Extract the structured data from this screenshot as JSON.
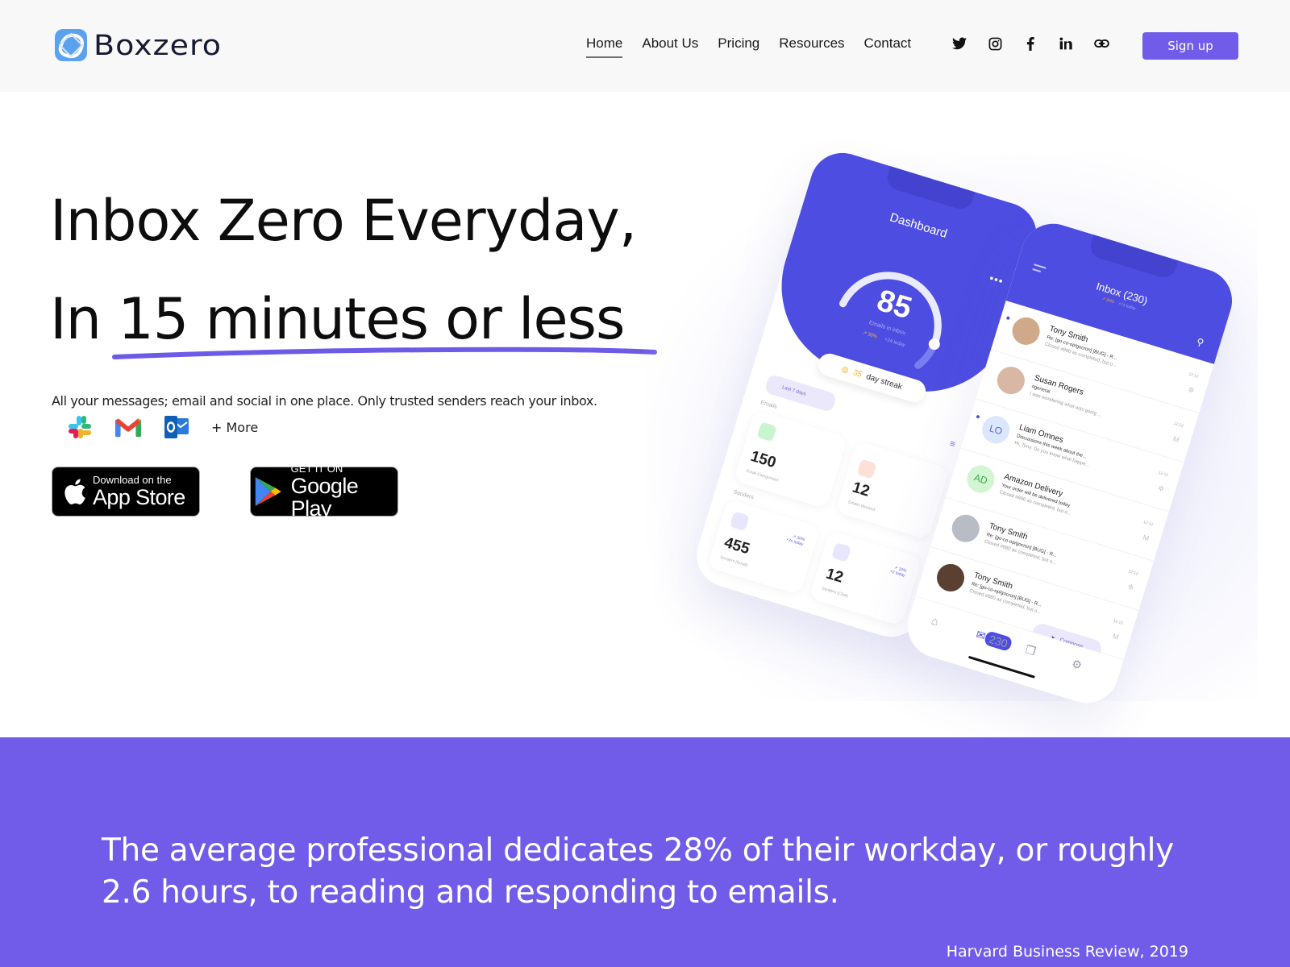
{
  "brand": {
    "name": "Boxzero",
    "accent": "#705ce8",
    "logo_icon": "box-logo-icon"
  },
  "nav": {
    "items": [
      {
        "label": "Home",
        "active": true
      },
      {
        "label": "About Us",
        "active": false
      },
      {
        "label": "Pricing",
        "active": false
      },
      {
        "label": "Resources",
        "active": false
      },
      {
        "label": "Contact",
        "active": false
      }
    ]
  },
  "social": [
    "twitter-icon",
    "instagram-icon",
    "facebook-icon",
    "linkedin-icon",
    "link-icon"
  ],
  "signup_label": "Sign up",
  "hero": {
    "title_line1": "Inbox Zero Everyday,",
    "title_line2": "In 15 minutes or less",
    "subtitle": "All your messages; email and social in one place. Only trusted senders reach your inbox.",
    "integrations": [
      "slack-icon",
      "gmail-icon",
      "outlook-icon"
    ],
    "more_label": "+ More",
    "app_store": {
      "small": "Download on the",
      "big": "App Store"
    },
    "google_play": {
      "small": "GET IT ON",
      "big": "Google Play"
    }
  },
  "dashboard_phone": {
    "title": "Dashboard",
    "gauge_value": "85",
    "gauge_fraction": 0.85,
    "gauge_label": "Emails in inbox",
    "trend_up": "↗ 30%",
    "trend_today": "+24 today",
    "streak_count": "35",
    "streak_label": "day streak",
    "range_label": "Last 7 days",
    "emails_section": "Emails",
    "senders_section": "Senders",
    "cards": [
      {
        "value": "150",
        "label": "Email Categorised"
      },
      {
        "value": "12",
        "label": "Emails Blocked"
      },
      {
        "value": "455",
        "label": "Senders (Email)",
        "trend": "↗ 30%",
        "today": "+2x today"
      },
      {
        "value": "12",
        "label": "Senders (Chat)",
        "trend": "↗ 10%",
        "today": "+2 today"
      }
    ]
  },
  "inbox_phone": {
    "title": "Inbox (230)",
    "trend_up": "↗ 30%",
    "trend_today": "+74 today",
    "mails": [
      {
        "name": "Tony Smith",
        "subject": "Re: [go-co-op/gocron] [BUG] - R...",
        "preview": "Closed #880 as completed, but o...",
        "time": "12:12",
        "initials": "",
        "unread": true
      },
      {
        "name": "Susan Rogers",
        "subject": "#general",
        "preview": "I was wondering what was going ...",
        "time": "12:12",
        "initials": "",
        "unread": false
      },
      {
        "name": "Liam Omnes",
        "subject": "Discussions this week about the...",
        "preview": "Hi, Tony. Do you know what happe...",
        "time": "12:12",
        "initials": "LO",
        "unread": true
      },
      {
        "name": "Amazon Delivery",
        "subject": "Your order will be delivered today",
        "preview": "Closed #880 as completed, but o...",
        "time": "12:12",
        "initials": "AD",
        "unread": false
      },
      {
        "name": "Tony Smith",
        "subject": "Re: [go-co-op/gocron] [BUG] - R...",
        "preview": "Closed #880 as completed, but o...",
        "time": "12:12",
        "initials": "",
        "unread": false
      },
      {
        "name": "Tony Smith",
        "subject": "Re: [go-co-op/gocron] [BUG] - R...",
        "preview": "Closed #880 as completed, but o...",
        "time": "12:12",
        "initials": "",
        "unread": false
      },
      {
        "name": "Tony Smith",
        "subject": "Re: [go-co-op/gocron] [BUG] - R...",
        "preview": "",
        "time": "",
        "initials": "",
        "unread": true
      }
    ],
    "compose_label": "Compose",
    "badge": "230"
  },
  "stat": {
    "text": "The average professional dedicates 28% of their workday, or roughly 2.6 hours, to reading and responding to emails.",
    "citation": "Harvard Business Review, 2019"
  }
}
